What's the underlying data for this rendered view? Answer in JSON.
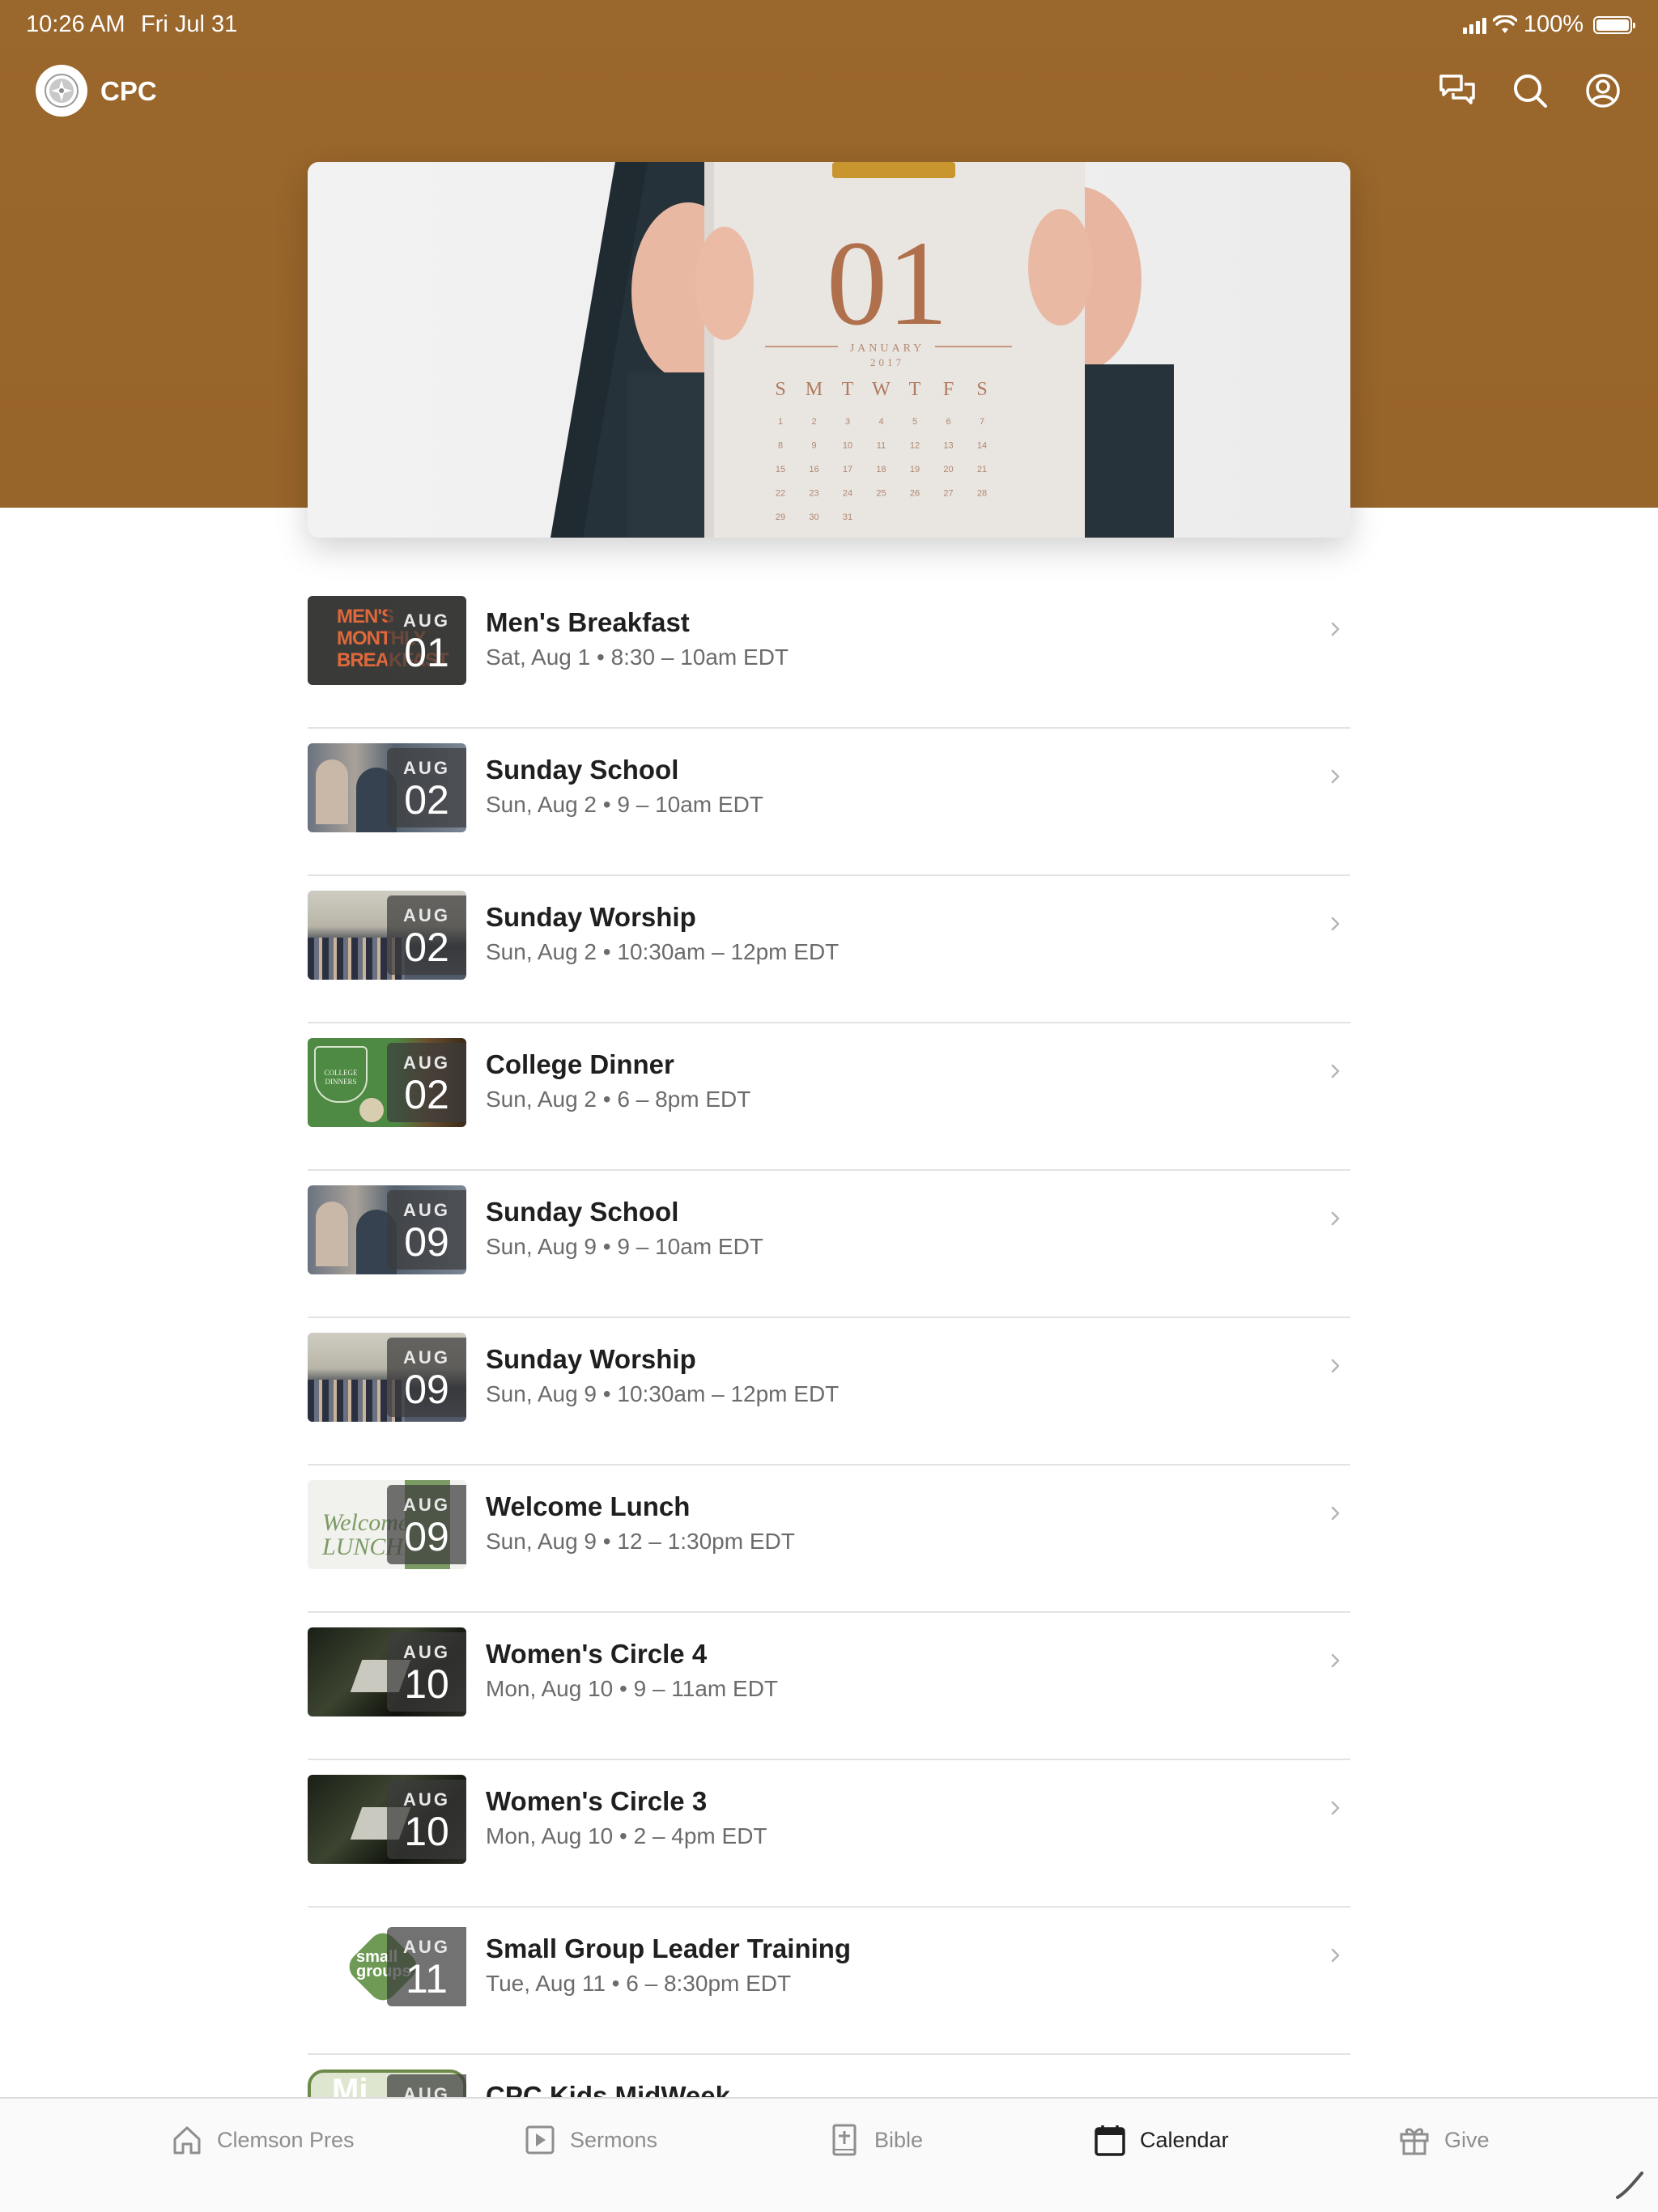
{
  "status_bar": {
    "time": "10:26 AM",
    "date": "Fri Jul 31",
    "battery": "100%"
  },
  "header": {
    "brand": "CPC"
  },
  "hero": {
    "big_number": "01",
    "month": "JANUARY",
    "year": "2017",
    "weekdays": [
      "S",
      "M",
      "T",
      "W",
      "T",
      "F",
      "S"
    ],
    "days": [
      "1",
      "2",
      "3",
      "4",
      "5",
      "6",
      "7",
      "8",
      "9",
      "10",
      "11",
      "12",
      "13",
      "14",
      "15",
      "16",
      "17",
      "18",
      "19",
      "20",
      "21",
      "22",
      "23",
      "24",
      "25",
      "26",
      "27",
      "28",
      "29",
      "30",
      "31"
    ]
  },
  "events": [
    {
      "month": "AUG",
      "day": "01",
      "title": "Men's Breakfast",
      "subtitle": "Sat, Aug 1 • 8:30 – 10am EDT",
      "thumb": "mens-breakfast",
      "thumb_text": "MEN'S\nMONTHLY\nBREAKFAST"
    },
    {
      "month": "AUG",
      "day": "02",
      "title": "Sunday School",
      "subtitle": "Sun, Aug 2 • 9 – 10am EDT",
      "thumb": "sunday-school"
    },
    {
      "month": "AUG",
      "day": "02",
      "title": "Sunday Worship",
      "subtitle": "Sun, Aug 2 • 10:30am – 12pm EDT",
      "thumb": "sunday-worship"
    },
    {
      "month": "AUG",
      "day": "02",
      "title": "College Dinner",
      "subtitle": "Sun, Aug 2 • 6 – 8pm EDT",
      "thumb": "college-dinner",
      "thumb_text": "COLLEGE\nDINNERS"
    },
    {
      "month": "AUG",
      "day": "09",
      "title": "Sunday School",
      "subtitle": "Sun, Aug 9 • 9 – 10am EDT",
      "thumb": "sunday-school"
    },
    {
      "month": "AUG",
      "day": "09",
      "title": "Sunday Worship",
      "subtitle": "Sun, Aug 9 • 10:30am – 12pm EDT",
      "thumb": "sunday-worship"
    },
    {
      "month": "AUG",
      "day": "09",
      "title": "Welcome Lunch",
      "subtitle": "Sun, Aug 9 • 12 – 1:30pm EDT",
      "thumb": "welcome-lunch",
      "thumb_text": "Welcome\nLUNCH"
    },
    {
      "month": "AUG",
      "day": "10",
      "title": "Women's Circle 4",
      "subtitle": "Mon, Aug 10 • 9 – 11am EDT",
      "thumb": "womens-circle"
    },
    {
      "month": "AUG",
      "day": "10",
      "title": "Women's Circle 3",
      "subtitle": "Mon, Aug 10 • 2 – 4pm EDT",
      "thumb": "womens-circle"
    },
    {
      "month": "AUG",
      "day": "11",
      "title": "Small Group Leader Training",
      "subtitle": "Tue, Aug 11 • 6 – 8:30pm EDT",
      "thumb": "small-groups",
      "thumb_text": "small\ngroups"
    },
    {
      "month": "AUG",
      "day": "",
      "title": "CPC Kids MidWeek",
      "subtitle": "",
      "thumb": "kids-midweek",
      "thumb_text": "Mi"
    }
  ],
  "tabs": [
    {
      "label": "Clemson Pres",
      "icon": "home-icon",
      "active": false
    },
    {
      "label": "Sermons",
      "icon": "play-icon",
      "active": false
    },
    {
      "label": "Bible",
      "icon": "bible-icon",
      "active": false
    },
    {
      "label": "Calendar",
      "icon": "calendar-icon",
      "active": true
    },
    {
      "label": "Give",
      "icon": "gift-icon",
      "active": false
    }
  ],
  "colors": {
    "header": "#9a672c",
    "accent": "#1f1f1f"
  }
}
